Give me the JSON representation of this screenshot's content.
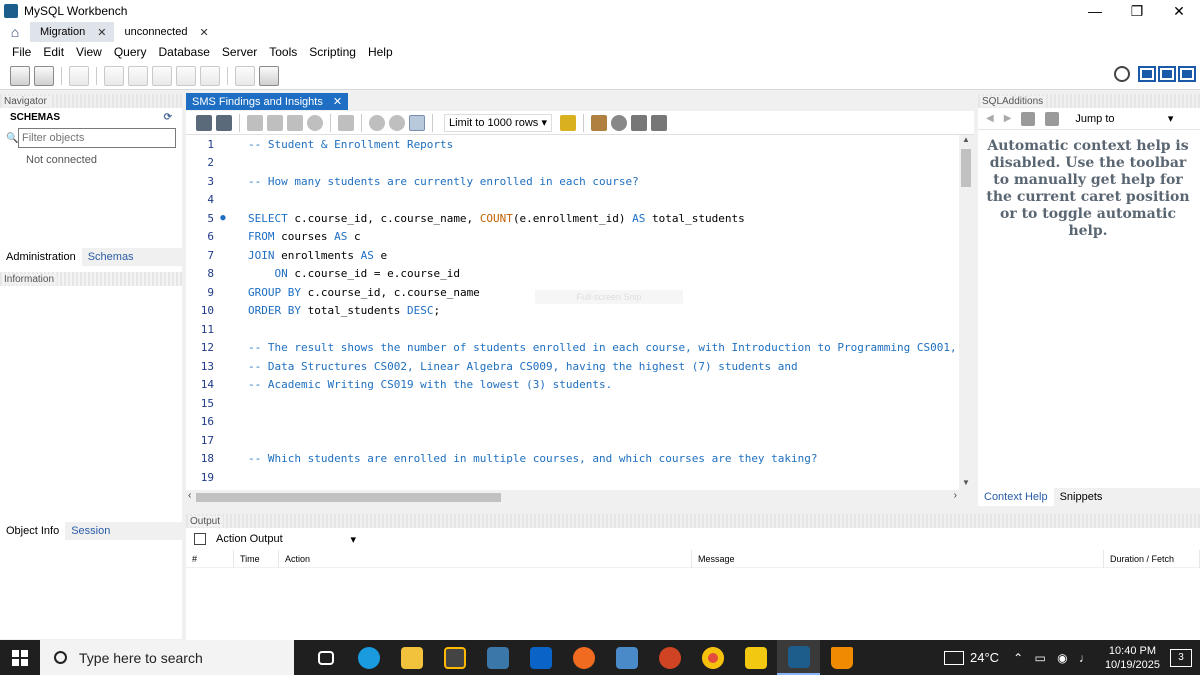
{
  "window": {
    "title": "MySQL Workbench",
    "controls": [
      "—",
      "❐",
      "✕"
    ]
  },
  "tabs": [
    {
      "label": "Migration",
      "close": "✕"
    },
    {
      "label": "unconnected",
      "close": "✕"
    }
  ],
  "menu": [
    "File",
    "Edit",
    "View",
    "Query",
    "Database",
    "Server",
    "Tools",
    "Scripting",
    "Help"
  ],
  "navigator": {
    "header": "Navigator",
    "schemas_title": "SCHEMAS",
    "filter_placeholder": "Filter objects",
    "status": "Not connected",
    "tabs": [
      "Administration",
      "Schemas"
    ],
    "info_header": "Information",
    "bottom_tabs": [
      "Object Info",
      "Session"
    ]
  },
  "editor": {
    "tab_label": "SMS Findings and Insights",
    "tab_close": "✕",
    "limit_label": "Limit to 1000 rows",
    "ghost_text": "Full-screen Snip",
    "lines": [
      {
        "n": "1",
        "text": "-- Student & Enrollment Reports"
      },
      {
        "n": "2",
        "text": ""
      },
      {
        "n": "3",
        "text": "-- How many students are currently enrolled in each course?"
      },
      {
        "n": "4",
        "text": ""
      },
      {
        "n": "5",
        "text": "SELECT c.course_id, c.course_name, COUNT(e.enrollment_id) AS total_students"
      },
      {
        "n": "6",
        "text": "FROM courses AS c"
      },
      {
        "n": "7",
        "text": "JOIN enrollments AS e"
      },
      {
        "n": "8",
        "text": "    ON c.course_id = e.course_id"
      },
      {
        "n": "9",
        "text": "GROUP BY c.course_id, c.course_name"
      },
      {
        "n": "10",
        "text": "ORDER BY total_students DESC;"
      },
      {
        "n": "11",
        "text": ""
      },
      {
        "n": "12",
        "text": "-- The result shows the number of students enrolled in each course, with Introduction to Programming CS001,"
      },
      {
        "n": "13",
        "text": "-- Data Structures CS002, Linear Algebra CS009, having the highest (7) students and"
      },
      {
        "n": "14",
        "text": "-- Academic Writing CS019 with the lowest (3) students."
      },
      {
        "n": "15",
        "text": ""
      },
      {
        "n": "16",
        "text": ""
      },
      {
        "n": "17",
        "text": ""
      },
      {
        "n": "18",
        "text": "-- Which students are enrolled in multiple courses, and which courses are they taking?"
      },
      {
        "n": "19",
        "text": ""
      }
    ]
  },
  "sql_additions": {
    "header": "SQLAdditions",
    "jump_label": "Jump to",
    "help_text": "Automatic context help is disabled. Use the toolbar to manually get help for the current caret position or to toggle automatic help.",
    "tabs": [
      "Context Help",
      "Snippets"
    ]
  },
  "output": {
    "header": "Output",
    "select_label": "Action Output",
    "columns": [
      "#",
      "Time",
      "Action",
      "Message",
      "Duration / Fetch"
    ]
  },
  "taskbar": {
    "search_placeholder": "Type here to search",
    "temperature": "24°C",
    "time": "10:40 PM",
    "date": "10/19/2025",
    "notifications": "3"
  }
}
